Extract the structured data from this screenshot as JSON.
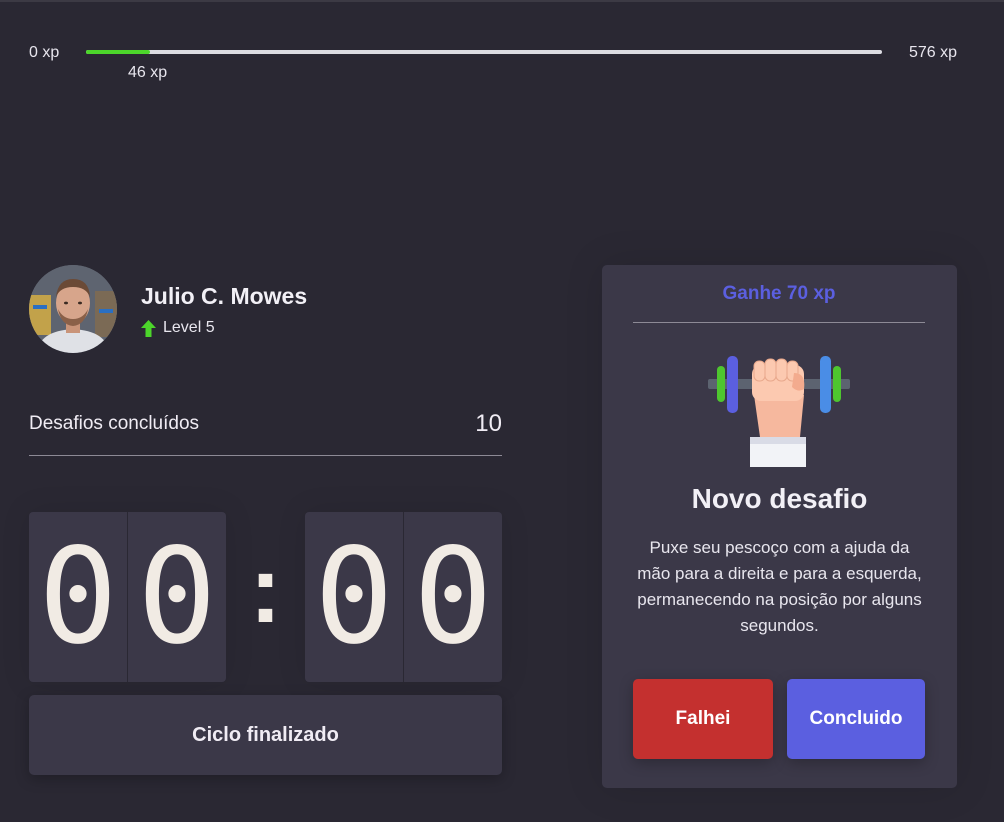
{
  "xp": {
    "min_label": "0 xp",
    "max_label": "576 xp",
    "current_label": "46 xp",
    "current_value": 46,
    "max_value": 576,
    "bar_color": "#4cd62b"
  },
  "profile": {
    "name": "Julio C. Mowes",
    "level_label": "Level 5",
    "level_icon": "level-up-arrow-icon"
  },
  "challenges": {
    "completed_label": "Desafios concluídos",
    "completed_count": "10"
  },
  "countdown": {
    "minute_left": "0",
    "minute_right": "0",
    "separator": ":",
    "second_left": "0",
    "second_right": "0"
  },
  "cycle_button_label": "Ciclo finalizado",
  "challenge_card": {
    "header": "Ganhe 70 xp",
    "icon": "dumbbell-icon",
    "title": "Novo desafio",
    "description": "Puxe seu pescoço com a ajuda da mão para a direita e para a esquerda, permanecendo na posição por alguns segundos.",
    "fail_label": "Falhei",
    "success_label": "Concluido",
    "accent_color": "#5b5fe0",
    "fail_color": "#c4302f"
  }
}
